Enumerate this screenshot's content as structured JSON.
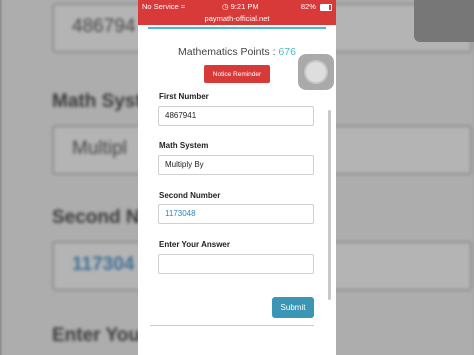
{
  "background": {
    "labels": [
      "Math Syst",
      "Second N",
      "Enter You"
    ],
    "boxes": [
      "486794",
      "Multipl",
      "117304"
    ]
  },
  "status_bar": {
    "carrier": "No Service",
    "time": "9:21 PM",
    "battery": "82%"
  },
  "browser": {
    "url": "paymath-official.net"
  },
  "form": {
    "points_label": "Mathematics Points :",
    "points_value": "676",
    "notice_button": "Notice Reminder",
    "first_number_label": "First Number",
    "first_number_value": "4867941",
    "math_system_label": "Math System",
    "math_system_value": "Multiply By",
    "second_number_label": "Second Number",
    "second_number_value": "1173048",
    "answer_label": "Enter Your Answer",
    "answer_value": "",
    "submit_button": "Submit"
  },
  "colors": {
    "status_bar": "#d83a3a",
    "accent": "#4fb8c9",
    "submit": "#3b95b5",
    "second_number_text": "#2b84c6"
  },
  "icons": [
    "wifi-icon",
    "alarm-icon",
    "battery-icon",
    "assistive-touch-icon"
  ]
}
